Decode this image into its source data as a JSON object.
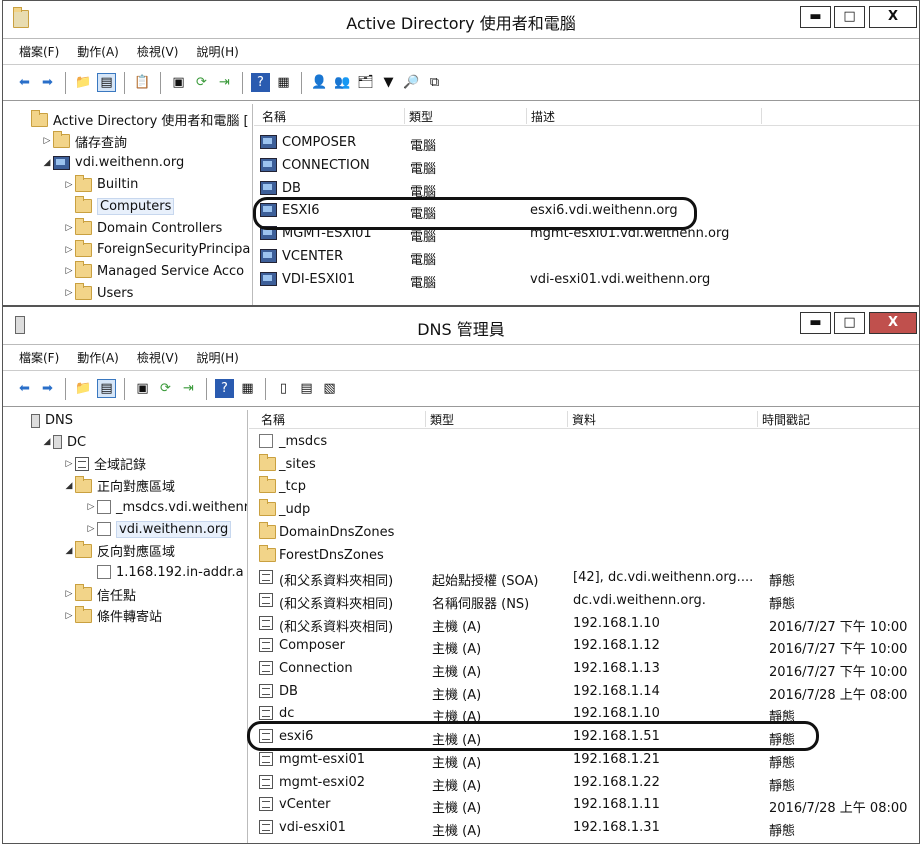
{
  "ad": {
    "title": "Active Directory 使用者和電腦",
    "controls": {
      "minimize": "▬",
      "maximize": "□",
      "close": "X"
    },
    "menu": [
      "檔案(F)",
      "動作(A)",
      "檢視(V)",
      "說明(H)"
    ],
    "tree": [
      {
        "label": "Active Directory 使用者和電腦 [",
        "icon": "ad-console-icon",
        "indent": 0,
        "exp": ""
      },
      {
        "label": "儲存查詢",
        "icon": "folder-icon",
        "indent": 1,
        "exp": "▷"
      },
      {
        "label": "vdi.weithenn.org",
        "icon": "domain-icon",
        "indent": 1,
        "exp": "◢"
      },
      {
        "label": "Builtin",
        "icon": "folder-icon",
        "indent": 2,
        "exp": "▷"
      },
      {
        "label": "Computers",
        "icon": "folder-icon",
        "indent": 2,
        "exp": "",
        "selected": true
      },
      {
        "label": "Domain Controllers",
        "icon": "folder-icon",
        "indent": 2,
        "exp": "▷"
      },
      {
        "label": "ForeignSecurityPrincipa",
        "icon": "folder-icon",
        "indent": 2,
        "exp": "▷"
      },
      {
        "label": "Managed Service Acco",
        "icon": "folder-icon",
        "indent": 2,
        "exp": "▷"
      },
      {
        "label": "Users",
        "icon": "folder-icon",
        "indent": 2,
        "exp": "▷"
      }
    ],
    "columns": [
      "名稱",
      "類型",
      "描述"
    ],
    "rows": [
      {
        "name": "COMPOSER",
        "type": "電腦",
        "desc": ""
      },
      {
        "name": "CONNECTION",
        "type": "電腦",
        "desc": ""
      },
      {
        "name": "DB",
        "type": "電腦",
        "desc": ""
      },
      {
        "name": "ESXI6",
        "type": "電腦",
        "desc": "esxi6.vdi.weithenn.org"
      },
      {
        "name": "MGMT-ESXI01",
        "type": "電腦",
        "desc": "mgmt-esxi01.vdi.weithenn.org"
      },
      {
        "name": "VCENTER",
        "type": "電腦",
        "desc": ""
      },
      {
        "name": "VDI-ESXI01",
        "type": "電腦",
        "desc": "vdi-esxi01.vdi.weithenn.org"
      }
    ]
  },
  "dns": {
    "title": "DNS 管理員",
    "controls": {
      "minimize": "▬",
      "maximize": "□",
      "close": "X"
    },
    "menu": [
      "檔案(F)",
      "動作(A)",
      "檢視(V)",
      "說明(H)"
    ],
    "tree": [
      {
        "label": "DNS",
        "icon": "dns-icon",
        "indent": 0,
        "exp": ""
      },
      {
        "label": "DC",
        "icon": "server-icon",
        "indent": 1,
        "exp": "◢"
      },
      {
        "label": "全域記錄",
        "icon": "global-logs-icon",
        "indent": 2,
        "exp": "▷"
      },
      {
        "label": "正向對應區域",
        "icon": "folder-icon",
        "indent": 2,
        "exp": "◢"
      },
      {
        "label": "_msdcs.vdi.weithenr",
        "icon": "zone-icon",
        "indent": 3,
        "exp": "▷"
      },
      {
        "label": "vdi.weithenn.org",
        "icon": "zone-icon",
        "indent": 3,
        "exp": "▷",
        "selected": true
      },
      {
        "label": "反向對應區域",
        "icon": "folder-icon",
        "indent": 2,
        "exp": "◢"
      },
      {
        "label": "1.168.192.in-addr.a",
        "icon": "zone-icon",
        "indent": 3,
        "exp": ""
      },
      {
        "label": "信任點",
        "icon": "folder-icon",
        "indent": 2,
        "exp": "▷"
      },
      {
        "label": "條件轉寄站",
        "icon": "folder-icon",
        "indent": 2,
        "exp": "▷"
      }
    ],
    "columns": [
      "名稱",
      "類型",
      "資料",
      "時間戳記"
    ],
    "rows": [
      {
        "name": "_msdcs",
        "type": "",
        "data": "",
        "ts": "",
        "icon": "zone"
      },
      {
        "name": "_sites",
        "type": "",
        "data": "",
        "ts": "",
        "icon": "folder"
      },
      {
        "name": "_tcp",
        "type": "",
        "data": "",
        "ts": "",
        "icon": "folder"
      },
      {
        "name": "_udp",
        "type": "",
        "data": "",
        "ts": "",
        "icon": "folder"
      },
      {
        "name": "DomainDnsZones",
        "type": "",
        "data": "",
        "ts": "",
        "icon": "folder"
      },
      {
        "name": "ForestDnsZones",
        "type": "",
        "data": "",
        "ts": "",
        "icon": "folder"
      },
      {
        "name": "(和父系資料夾相同)",
        "type": "起始點授權 (SOA)",
        "data": "[42], dc.vdi.weithenn.org....",
        "ts": "靜態",
        "icon": "rec"
      },
      {
        "name": "(和父系資料夾相同)",
        "type": "名稱伺服器 (NS)",
        "data": "dc.vdi.weithenn.org.",
        "ts": "靜態",
        "icon": "rec"
      },
      {
        "name": "(和父系資料夾相同)",
        "type": "主機 (A)",
        "data": "192.168.1.10",
        "ts": "2016/7/27 下午 10:00",
        "icon": "rec"
      },
      {
        "name": "Composer",
        "type": "主機 (A)",
        "data": "192.168.1.12",
        "ts": "2016/7/27 下午 10:00",
        "icon": "rec"
      },
      {
        "name": "Connection",
        "type": "主機 (A)",
        "data": "192.168.1.13",
        "ts": "2016/7/27 下午 10:00",
        "icon": "rec"
      },
      {
        "name": "DB",
        "type": "主機 (A)",
        "data": "192.168.1.14",
        "ts": "2016/7/28 上午 08:00",
        "icon": "rec"
      },
      {
        "name": "dc",
        "type": "主機 (A)",
        "data": "192.168.1.10",
        "ts": "靜態",
        "icon": "rec"
      },
      {
        "name": "esxi6",
        "type": "主機 (A)",
        "data": "192.168.1.51",
        "ts": "靜態",
        "icon": "rec"
      },
      {
        "name": "mgmt-esxi01",
        "type": "主機 (A)",
        "data": "192.168.1.21",
        "ts": "靜態",
        "icon": "rec"
      },
      {
        "name": "mgmt-esxi02",
        "type": "主機 (A)",
        "data": "192.168.1.22",
        "ts": "靜態",
        "icon": "rec"
      },
      {
        "name": "vCenter",
        "type": "主機 (A)",
        "data": "192.168.1.11",
        "ts": "2016/7/28 上午 08:00",
        "icon": "rec"
      },
      {
        "name": "vdi-esxi01",
        "type": "主機 (A)",
        "data": "192.168.1.31",
        "ts": "靜態",
        "icon": "rec"
      }
    ]
  },
  "colors": {
    "selection": "#d6e6f8",
    "close_button": "#c0504d",
    "folder": "#f2d489"
  }
}
